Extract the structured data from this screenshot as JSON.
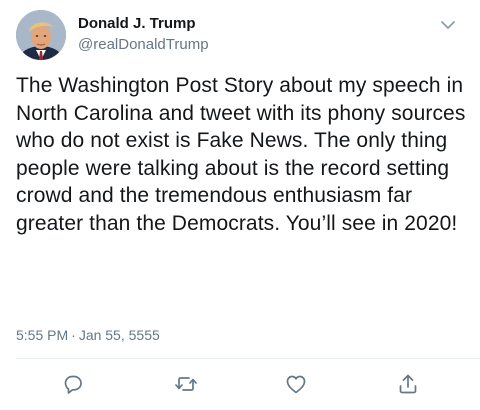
{
  "author": {
    "display_name": "Donald J. Trump",
    "handle": "@realDonaldTrump",
    "avatar_icon": "profile-photo"
  },
  "tweet": {
    "text": "The Washington Post Story about my speech in North Carolina and tweet with its phony sources who do not exist is Fake News. The only thing people were talking about is the record setting crowd and the tremendous enthusiasm far greater than the Democrats. You’ll see in 2020!",
    "time": "5:55 PM",
    "separator": "·",
    "date": "Jan 55, 5555"
  },
  "actions": [
    {
      "name": "reply",
      "icon": "reply-icon"
    },
    {
      "name": "retweet",
      "icon": "retweet-icon"
    },
    {
      "name": "like",
      "icon": "heart-icon"
    },
    {
      "name": "share",
      "icon": "share-icon"
    }
  ],
  "colors": {
    "text": "#14171a",
    "secondary": "#657786",
    "icon": "#657786",
    "divider": "#e6ecf0"
  }
}
